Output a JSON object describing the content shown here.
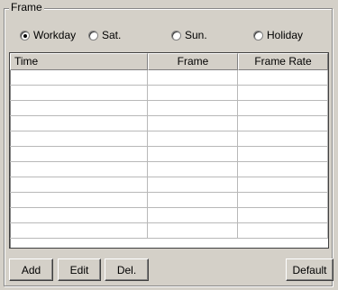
{
  "group": {
    "title": "Frame"
  },
  "day_type": {
    "options": [
      {
        "label": "Workday",
        "checked": true
      },
      {
        "label": "Sat.",
        "checked": false
      },
      {
        "label": "Sun.",
        "checked": false
      },
      {
        "label": "Holiday",
        "checked": false
      }
    ]
  },
  "table": {
    "columns": [
      "Time",
      "Frame",
      "Frame Rate"
    ],
    "row_count": 11
  },
  "buttons": {
    "add": "Add",
    "edit": "Edit",
    "del": "Del.",
    "default": "Default"
  }
}
